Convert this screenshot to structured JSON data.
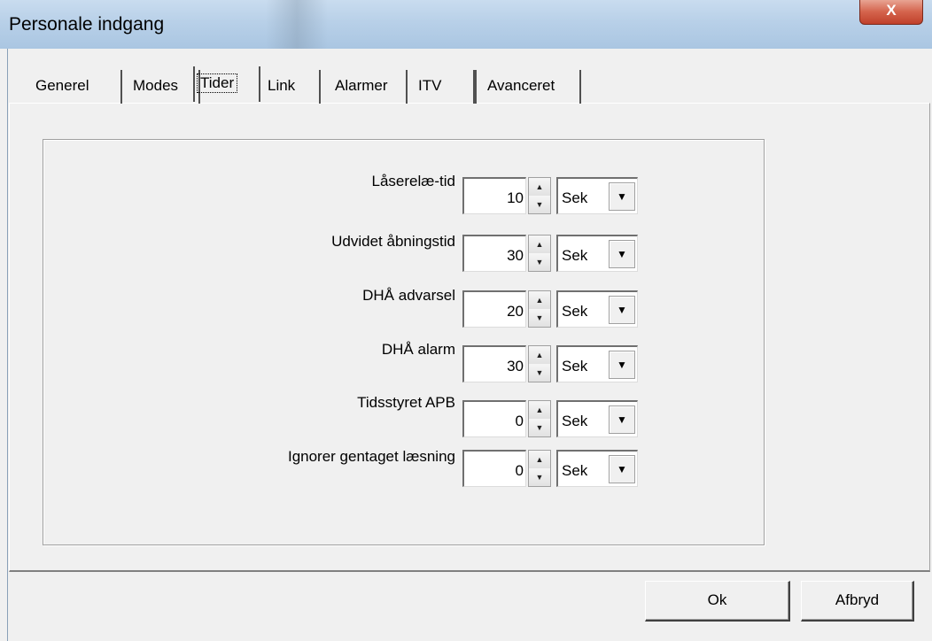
{
  "window": {
    "title": "Personale indgang",
    "close_label": "X"
  },
  "tabs": [
    {
      "label": "Generel",
      "active": false
    },
    {
      "label": "Modes",
      "active": false
    },
    {
      "label": "Tider",
      "active": true
    },
    {
      "label": "Link",
      "active": false
    },
    {
      "label": "Alarmer",
      "active": false
    },
    {
      "label": "ITV",
      "active": false
    },
    {
      "label": "Avanceret",
      "active": false
    }
  ],
  "timers": [
    {
      "label": "Låserelæ-tid",
      "value": "10",
      "unit": "Sek"
    },
    {
      "label": "Udvidet åbningstid",
      "value": "30",
      "unit": "Sek"
    },
    {
      "label": "DHÅ advarsel",
      "value": "20",
      "unit": "Sek"
    },
    {
      "label": "DHÅ alarm",
      "value": "30",
      "unit": "Sek"
    },
    {
      "label": "Tidsstyret APB",
      "value": "0",
      "unit": "Sek"
    },
    {
      "label": "Ignorer gentaget læsning",
      "value": "0",
      "unit": "Sek"
    }
  ],
  "icons": {
    "spin_up": "arrow-up-icon",
    "spin_down": "arrow-down-icon",
    "dropdown": "chevron-down-icon"
  },
  "buttons": {
    "ok_label": "Ok",
    "cancel_label": "Afbryd"
  }
}
